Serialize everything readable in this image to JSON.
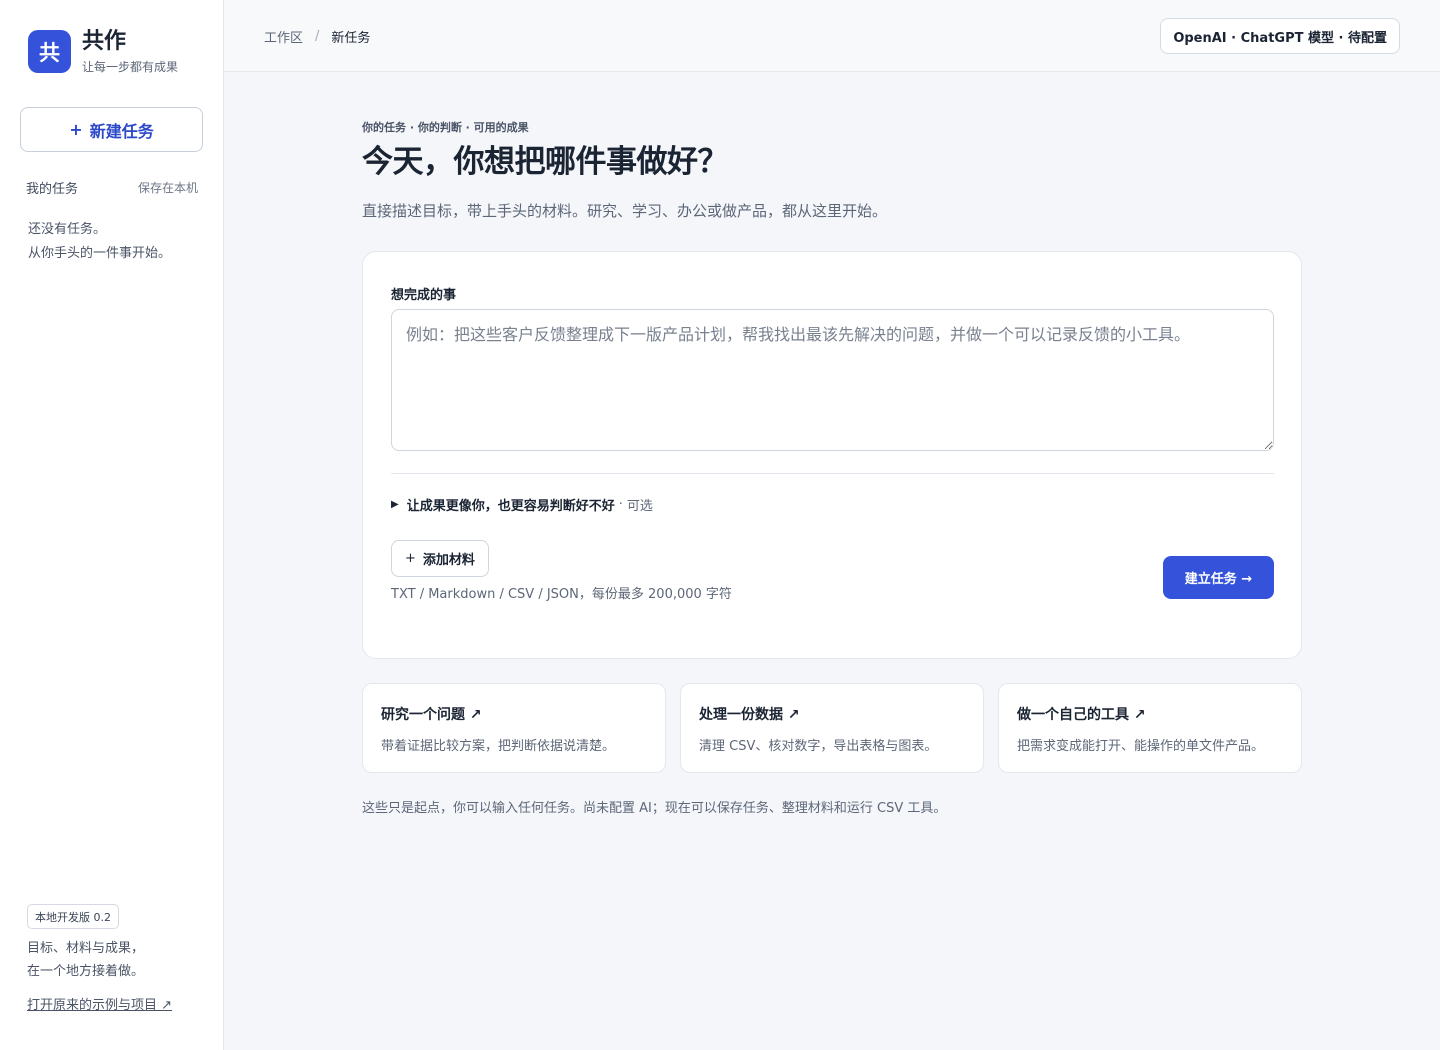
{
  "brand": {
    "logo_char": "共",
    "name": "共作",
    "tagline": "让每一步都有成果"
  },
  "sidebar": {
    "new_task": {
      "icon": "plus-icon",
      "icon_char": "+",
      "label": "新建任务"
    },
    "tasks_title": "我的任务",
    "tasks_saved": "保存在本机",
    "empty_line1": "还没有任务。",
    "empty_line2": "从你手头的一件事开始。",
    "version": "本地开发版 0.2",
    "desc_line1": "目标、材料与成果，",
    "desc_line2": "在一个地方接着做。",
    "link": "打开原来的示例与项目 ↗"
  },
  "topbar": {
    "breadcrumb": [
      "工作区",
      "新任务"
    ],
    "separator": "/",
    "model_status": "OpenAI · ChatGPT 模型 · 待配置"
  },
  "main": {
    "eyebrow": "你的任务 · 你的判断 · 可用的成果",
    "title": "今天，你想把哪件事做好？",
    "subtitle": "直接描述目标，带上手头的材料。研究、学习、办公或做产品，都从这里开始。",
    "form": {
      "label": "想完成的事",
      "placeholder": "例如：把这些客户反馈整理成下一版产品计划，帮我找出最该先解决的问题，并做一个可以记录反馈的小工具。",
      "value": "",
      "optional_icon": "triangle-right-icon",
      "optional_icon_char": "▶",
      "optional_label": "让成果更像你，也更容易判断好不好",
      "optional_sep": "·",
      "optional_tag": "可选",
      "add_material_icon_char": "+",
      "add_material": "添加材料",
      "file_hint": "TXT / Markdown / CSV / JSON，每份最多 200,000 字符",
      "submit": "建立任务 →"
    },
    "quick_starts": [
      {
        "title": "研究一个问题 ↗",
        "desc": "带着证据比较方案，把判断依据说清楚。"
      },
      {
        "title": "处理一份数据 ↗",
        "desc": "清理 CSV、核对数字，导出表格与图表。"
      },
      {
        "title": "做一个自己的工具 ↗",
        "desc": "把需求变成能打开、能操作的单文件产品。"
      }
    ],
    "footer_note": "这些只是起点，你可以输入任何任务。尚未配置 AI；现在可以保存任务、整理材料和运行 CSV 工具。"
  },
  "colors": {
    "accent": "#3552db",
    "background": "#f4f6fa",
    "text": "#1b2433"
  }
}
